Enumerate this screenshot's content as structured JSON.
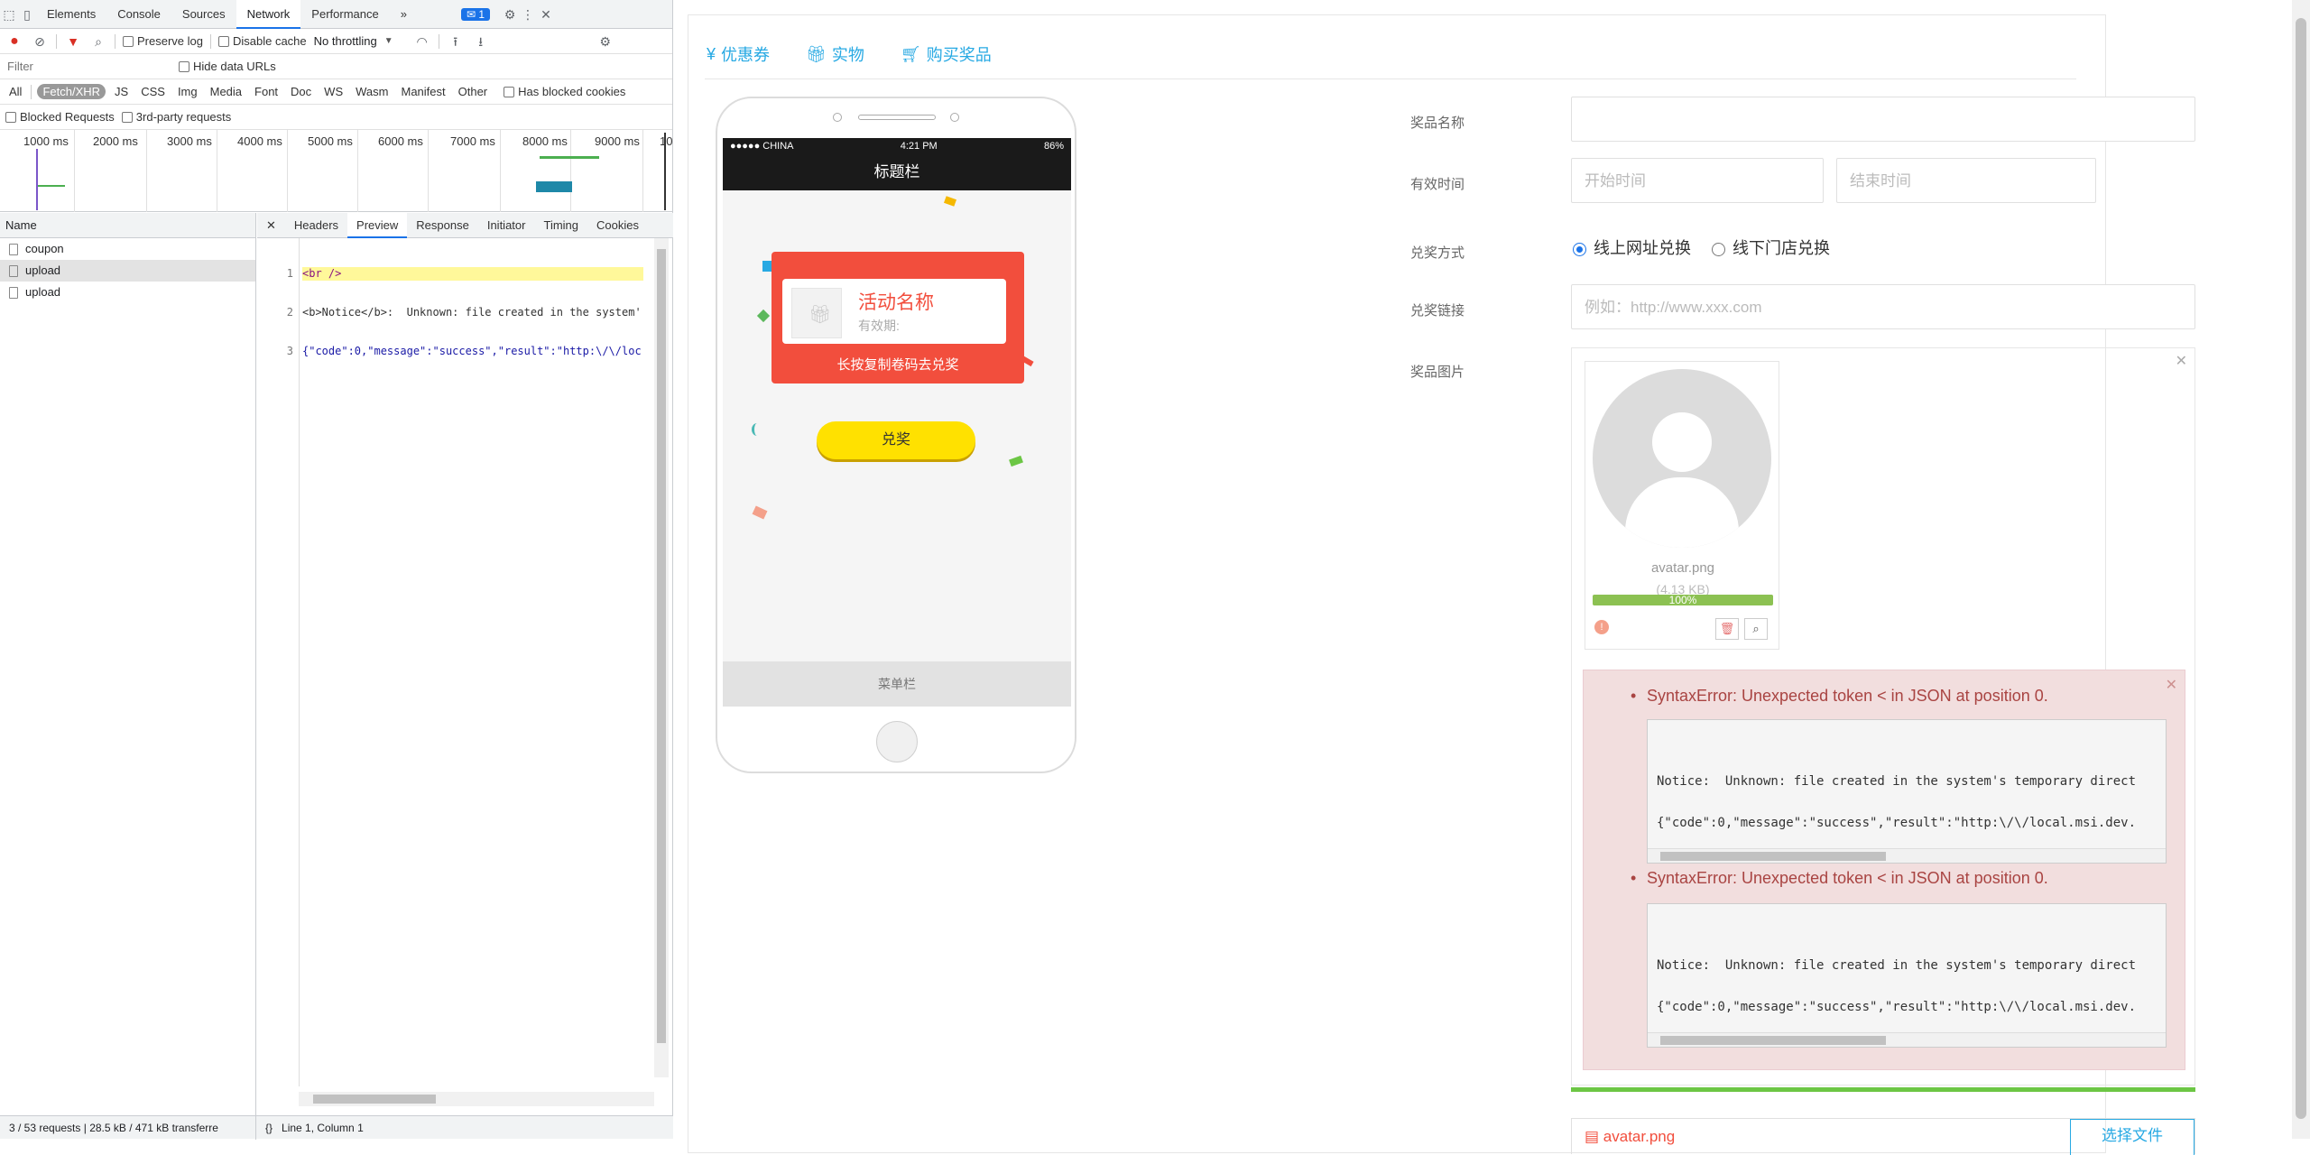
{
  "devtools": {
    "tabs": [
      "Elements",
      "Console",
      "Sources",
      "Network",
      "Performance"
    ],
    "more_tabs": "»",
    "issues_badge": "1",
    "preserve_log": "Preserve log",
    "disable_cache": "Disable cache",
    "throttling": "No throttling",
    "filter_placeholder": "Filter",
    "hide_data_urls": "Hide data URLs",
    "types": [
      "All",
      "Fetch/XHR",
      "JS",
      "CSS",
      "Img",
      "Media",
      "Font",
      "Doc",
      "WS",
      "Wasm",
      "Manifest",
      "Other"
    ],
    "has_blocked_cookies": "Has blocked cookies",
    "blocked_requests": "Blocked Requests",
    "third_party": "3rd-party requests",
    "timeline_ticks": [
      "1000 ms",
      "2000 ms",
      "3000 ms",
      "4000 ms",
      "5000 ms",
      "6000 ms",
      "7000 ms",
      "8000 ms",
      "9000 ms",
      "10"
    ],
    "name_header": "Name",
    "requests": [
      "coupon",
      "upload",
      "upload"
    ],
    "detail_tabs": [
      "Headers",
      "Preview",
      "Response",
      "Initiator",
      "Timing",
      "Cookies"
    ],
    "preview_line_numbers": [
      "1",
      "2",
      "3"
    ],
    "preview_lines": [
      "<br />",
      "<b>Notice</b>:  Unknown: file created in the system'",
      "{\"code\":0,\"message\":\"success\",\"result\":\"http:\\/\\/loc"
    ],
    "status_requests": "3 / 53 requests",
    "status_transferred": "28.5 kB / 471 kB transferre",
    "status_position": "Line 1, Column 1"
  },
  "app": {
    "tabs": [
      {
        "icon": "yen-icon",
        "label": "优惠券"
      },
      {
        "icon": "gift-icon",
        "label": "实物"
      },
      {
        "icon": "cart-icon",
        "label": "购买奖品"
      }
    ],
    "phone": {
      "carrier": "●●●●● CHINA",
      "time": "4:21 PM",
      "battery": "86%",
      "title": "标题栏",
      "activity_name": "活动名称",
      "validity": "有效期:",
      "card_footer": "长按复制卷码去兑奖",
      "redeem_button": "兑奖",
      "menu_bar": "菜单栏"
    },
    "form": {
      "prize_name_label": "奖品名称",
      "prize_name_value": "",
      "valid_time_label": "有效时间",
      "start_placeholder": "开始时间",
      "end_placeholder": "结束时间",
      "redeem_method_label": "兑奖方式",
      "redeem_options": [
        "线上网址兑换",
        "线下门店兑换"
      ],
      "redeem_selected": "线上网址兑换",
      "redeem_link_label": "兑奖链接",
      "redeem_link_placeholder": "例如：http://www.xxx.com",
      "prize_image_label": "奖品图片"
    },
    "upload": {
      "filename": "avatar.png",
      "filesize": "(4.13 KB)",
      "progress_text": "100%",
      "progress": 1.0,
      "errors": [
        {
          "message": "SyntaxError: Unexpected token < in JSON at position 0.",
          "code_line1": "Notice:  Unknown: file created in the system's temporary direct",
          "code_line2": "{\"code\":0,\"message\":\"success\",\"result\":\"http:\\/\\/local.msi.dev."
        },
        {
          "message": "SyntaxError: Unexpected token < in JSON at position 0.",
          "code_line1": "Notice:  Unknown: file created in the system's temporary direct",
          "code_line2": "{\"code\":0,\"message\":\"success\",\"result\":\"http:\\/\\/local.msi.dev."
        }
      ],
      "bottom_file": "avatar.png",
      "choose_file": "选择文件"
    }
  },
  "colors": {
    "accent": "#27a9e3",
    "coupon_red": "#f24e3d",
    "redeem_yellow": "#ffe100",
    "progress_green": "#8cc152",
    "error_red": "#a94442"
  }
}
